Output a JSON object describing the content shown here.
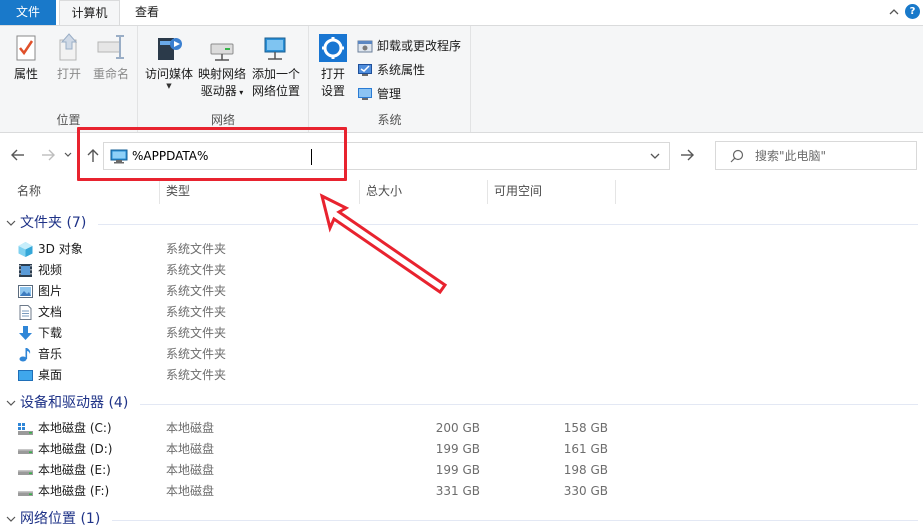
{
  "tabs": {
    "file": "文件",
    "computer": "计算机",
    "view": "查看"
  },
  "ribbon": {
    "location": {
      "label": "位置",
      "properties": "属性",
      "open": "打开",
      "rename": "重命名"
    },
    "network": {
      "label": "网络",
      "access_media": "访问媒体",
      "map_drive_line1": "映射网络",
      "map_drive_line2": "驱动器",
      "add_location_line1": "添加一个",
      "add_location_line2": "网络位置"
    },
    "system": {
      "label": "系统",
      "open_settings_line1": "打开",
      "open_settings_line2": "设置",
      "uninstall": "卸载或更改程序",
      "system_properties": "系统属性",
      "manage": "管理"
    }
  },
  "address": {
    "value": "%APPDATA%"
  },
  "search": {
    "placeholder": "搜索\"此电脑\""
  },
  "columns": {
    "name": "名称",
    "type": "类型",
    "total_size": "总大小",
    "free_space": "可用空间"
  },
  "groups": {
    "folders": {
      "title": "文件夹 (7)",
      "items": [
        {
          "name": "3D 对象",
          "type": "系统文件夹",
          "icon": "3d-objects-icon"
        },
        {
          "name": "视频",
          "type": "系统文件夹",
          "icon": "video-icon"
        },
        {
          "name": "图片",
          "type": "系统文件夹",
          "icon": "pictures-icon"
        },
        {
          "name": "文档",
          "type": "系统文件夹",
          "icon": "documents-icon"
        },
        {
          "name": "下载",
          "type": "系统文件夹",
          "icon": "downloads-icon"
        },
        {
          "name": "音乐",
          "type": "系统文件夹",
          "icon": "music-icon"
        },
        {
          "name": "桌面",
          "type": "系统文件夹",
          "icon": "desktop-icon"
        }
      ]
    },
    "drives": {
      "title": "设备和驱动器 (4)",
      "items": [
        {
          "name": "本地磁盘 (C:)",
          "type": "本地磁盘",
          "total": "200 GB",
          "free": "158 GB"
        },
        {
          "name": "本地磁盘 (D:)",
          "type": "本地磁盘",
          "total": "199 GB",
          "free": "161 GB"
        },
        {
          "name": "本地磁盘 (E:)",
          "type": "本地磁盘",
          "total": "199 GB",
          "free": "198 GB"
        },
        {
          "name": "本地磁盘 (F:)",
          "type": "本地磁盘",
          "total": "331 GB",
          "free": "330 GB"
        }
      ]
    },
    "network": {
      "title": "网络位置 (1)"
    }
  },
  "colors": {
    "accent": "#1979ca",
    "group_header": "#1e3287",
    "highlight": "#e8232f"
  }
}
